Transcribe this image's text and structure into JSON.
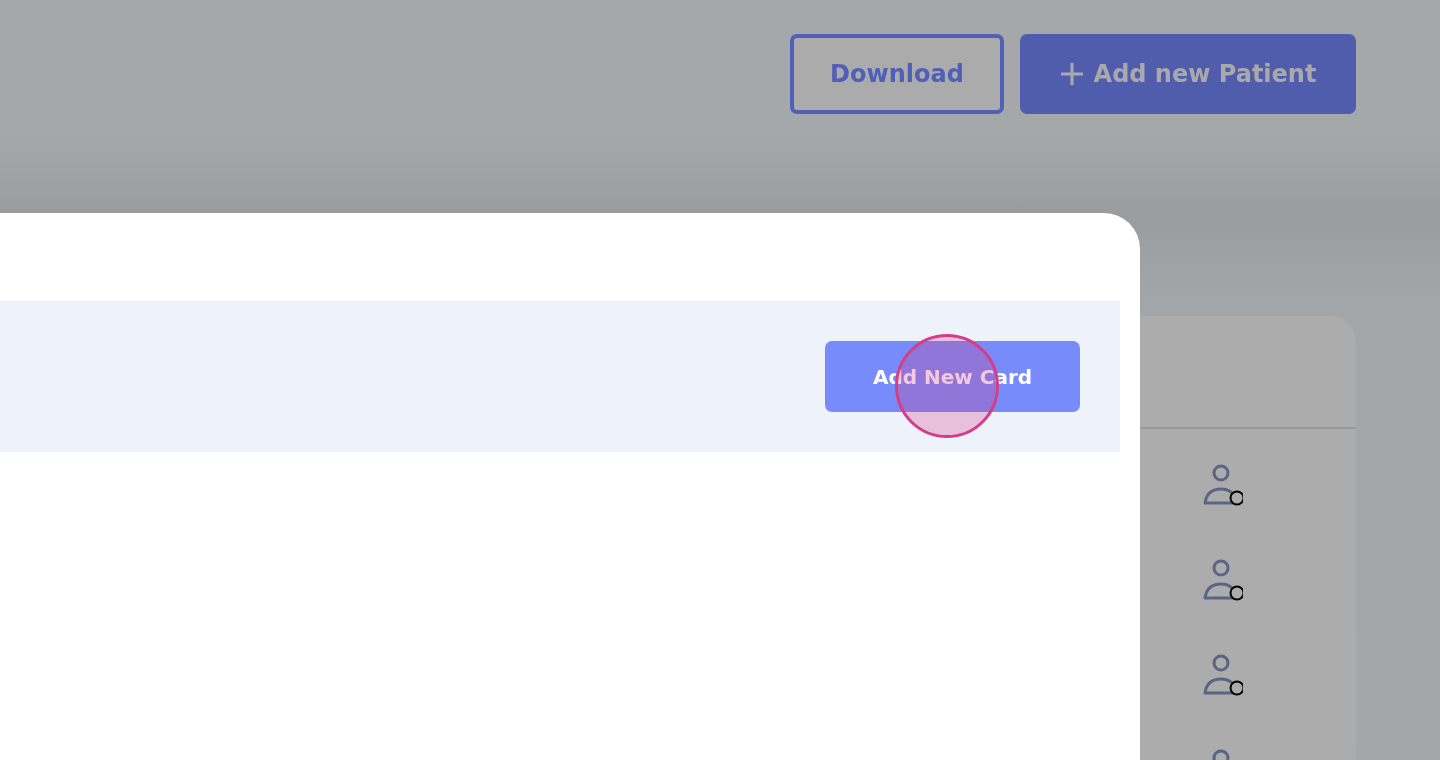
{
  "header": {
    "buttons": [
      {
        "label": "Download",
        "kind": "outline"
      },
      {
        "label": "Add new Patient",
        "kind": "primary"
      }
    ]
  },
  "modal": {
    "action_button": {
      "label": "Add New Card"
    },
    "click_indicator": true
  }
}
